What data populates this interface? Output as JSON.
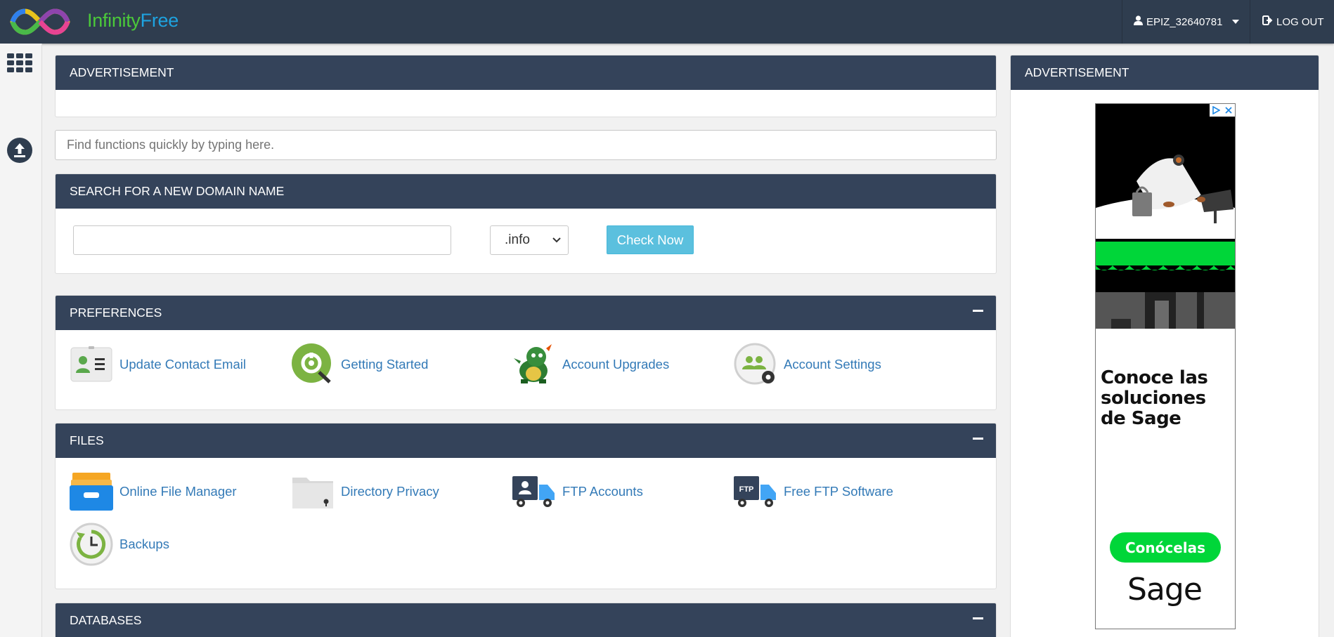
{
  "header": {
    "brand_part1": "Infinity",
    "brand_part2": "Free",
    "username": "EPIZ_32640781",
    "logout_label": "LOG OUT"
  },
  "top_ad": {
    "title": "ADVERTISEMENT"
  },
  "function_search": {
    "placeholder": "Find functions quickly by typing here."
  },
  "domain_search": {
    "title": "SEARCH FOR A NEW DOMAIN NAME",
    "value": "",
    "tld_selected": ".info",
    "button_label": "Check Now"
  },
  "preferences": {
    "title": "PREFERENCES",
    "items": [
      {
        "label": "Update Contact Email",
        "icon": "contact-card-icon"
      },
      {
        "label": "Getting Started",
        "icon": "getting-started-icon"
      },
      {
        "label": "Account Upgrades",
        "icon": "dragon-mascot-icon"
      },
      {
        "label": "Account Settings",
        "icon": "account-settings-icon"
      }
    ]
  },
  "files": {
    "title": "FILES",
    "items": [
      {
        "label": "Online File Manager",
        "icon": "file-manager-icon"
      },
      {
        "label": "Directory Privacy",
        "icon": "locked-folder-icon"
      },
      {
        "label": "FTP Accounts",
        "icon": "ftp-truck-icon"
      },
      {
        "label": "Free FTP Software",
        "icon": "ftp-software-truck-icon"
      },
      {
        "label": "Backups",
        "icon": "backup-clock-icon"
      }
    ]
  },
  "databases": {
    "title": "DATABASES"
  },
  "side_ad": {
    "title": "ADVERTISEMENT",
    "headline_line1": "Conoce las",
    "headline_line2": "soluciones",
    "headline_line3": "de Sage",
    "cta_label": "Conócelas",
    "brand": "Sage"
  },
  "colors": {
    "topbar": "#2f3d4f",
    "panel_header": "#34435a",
    "link": "#337ab7",
    "check_button": "#5bc0de",
    "ad_green": "#00d639"
  }
}
